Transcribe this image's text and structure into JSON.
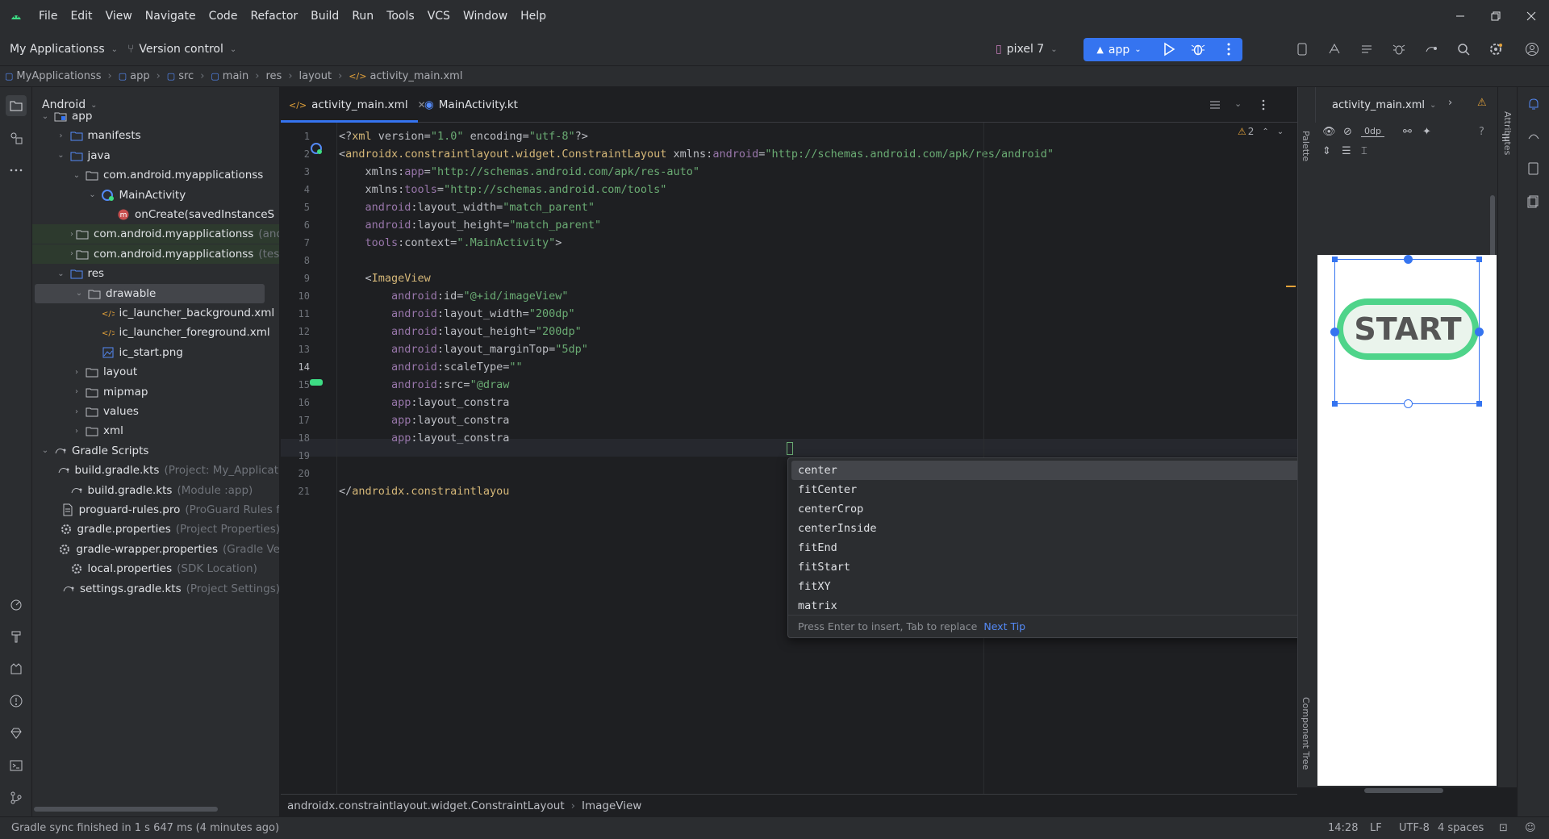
{
  "menu": [
    "File",
    "Edit",
    "View",
    "Navigate",
    "Code",
    "Refactor",
    "Build",
    "Run",
    "Tools",
    "VCS",
    "Window",
    "Help"
  ],
  "toolbar": {
    "project_name": "My Applicationss",
    "vcs_label": "Version control",
    "device": "pixel 7",
    "run_config": "app"
  },
  "breadcrumb": [
    "MyApplicationss",
    "app",
    "src",
    "main",
    "res",
    "layout",
    "activity_main.xml"
  ],
  "project_panel": {
    "view_mode": "Android",
    "tree": [
      {
        "label": "app",
        "dim": ""
      },
      {
        "label": "manifests",
        "dim": ""
      },
      {
        "label": "java",
        "dim": ""
      },
      {
        "label": "com.android.myapplicationss",
        "dim": ""
      },
      {
        "label": "MainActivity",
        "dim": ""
      },
      {
        "label": "onCreate(savedInstanceS",
        "dim": ""
      },
      {
        "label": "com.android.myapplicationss",
        "dim": "(andr"
      },
      {
        "label": "com.android.myapplicationss",
        "dim": "(test"
      },
      {
        "label": "res",
        "dim": ""
      },
      {
        "label": "drawable",
        "dim": ""
      },
      {
        "label": "ic_launcher_background.xml",
        "dim": ""
      },
      {
        "label": "ic_launcher_foreground.xml",
        "dim": ""
      },
      {
        "label": "ic_start.png",
        "dim": ""
      },
      {
        "label": "layout",
        "dim": ""
      },
      {
        "label": "mipmap",
        "dim": ""
      },
      {
        "label": "values",
        "dim": ""
      },
      {
        "label": "xml",
        "dim": ""
      },
      {
        "label": "Gradle Scripts",
        "dim": ""
      },
      {
        "label": "build.gradle.kts",
        "dim": "(Project: My_Applicati"
      },
      {
        "label": "build.gradle.kts",
        "dim": "(Module :app)"
      },
      {
        "label": "proguard-rules.pro",
        "dim": "(ProGuard Rules f"
      },
      {
        "label": "gradle.properties",
        "dim": "(Project Properties)"
      },
      {
        "label": "gradle-wrapper.properties",
        "dim": "(Gradle Ve"
      },
      {
        "label": "local.properties",
        "dim": "(SDK Location)"
      },
      {
        "label": "settings.gradle.kts",
        "dim": "(Project Settings)"
      }
    ]
  },
  "editor": {
    "tabs": [
      "activity_main.xml",
      "MainActivity.kt"
    ],
    "warning_count": "2",
    "lines": [
      [
        {
          "c": "ps",
          "t": "<?"
        },
        {
          "c": "tg",
          "t": "xml "
        },
        {
          "c": "at",
          "t": "version="
        },
        {
          "c": "sv",
          "t": "\"1.0\""
        },
        {
          "c": "at",
          "t": " encoding="
        },
        {
          "c": "sv",
          "t": "\"utf-8\""
        },
        {
          "c": "ps",
          "t": "?>"
        }
      ],
      [
        {
          "c": "ps",
          "t": "<"
        },
        {
          "c": "tg",
          "t": "androidx.constraintlayout.widget.ConstraintLayout "
        },
        {
          "c": "at",
          "t": "xmlns:"
        },
        {
          "c": "ns",
          "t": "android"
        },
        {
          "c": "at",
          "t": "="
        },
        {
          "c": "sv",
          "t": "\"http://schemas.android.com/apk/res/android\""
        }
      ],
      [
        {
          "c": "at",
          "t": "    xmlns:"
        },
        {
          "c": "ns",
          "t": "app"
        },
        {
          "c": "at",
          "t": "="
        },
        {
          "c": "sv",
          "t": "\"http://schemas.android.com/apk/res-auto\""
        }
      ],
      [
        {
          "c": "at",
          "t": "    xmlns:"
        },
        {
          "c": "ns",
          "t": "tools"
        },
        {
          "c": "at",
          "t": "="
        },
        {
          "c": "sv",
          "t": "\"http://schemas.android.com/tools\""
        }
      ],
      [
        {
          "c": "ns",
          "t": "    android"
        },
        {
          "c": "at",
          "t": ":layout_width="
        },
        {
          "c": "sv",
          "t": "\"match_parent\""
        }
      ],
      [
        {
          "c": "ns",
          "t": "    android"
        },
        {
          "c": "at",
          "t": ":layout_height="
        },
        {
          "c": "sv",
          "t": "\"match_parent\""
        }
      ],
      [
        {
          "c": "ns",
          "t": "    tools"
        },
        {
          "c": "at",
          "t": ":context="
        },
        {
          "c": "sv",
          "t": "\".MainActivity\""
        },
        {
          "c": "ps",
          "t": ">"
        }
      ],
      [],
      [
        {
          "c": "ps",
          "t": "    <"
        },
        {
          "c": "tg",
          "t": "ImageView"
        }
      ],
      [
        {
          "c": "ns",
          "t": "        android"
        },
        {
          "c": "at",
          "t": ":id="
        },
        {
          "c": "sv",
          "t": "\"@+id/imageView\""
        }
      ],
      [
        {
          "c": "ns",
          "t": "        android"
        },
        {
          "c": "at",
          "t": ":layout_width="
        },
        {
          "c": "sv",
          "t": "\"200dp\""
        }
      ],
      [
        {
          "c": "ns",
          "t": "        android"
        },
        {
          "c": "at",
          "t": ":layout_height="
        },
        {
          "c": "sv",
          "t": "\"200dp\""
        }
      ],
      [
        {
          "c": "ns",
          "t": "        android"
        },
        {
          "c": "at",
          "t": ":layout_marginTop="
        },
        {
          "c": "sv",
          "t": "\"5dp\""
        }
      ],
      [
        {
          "c": "ns",
          "t": "        android"
        },
        {
          "c": "at",
          "t": ":scaleType="
        },
        {
          "c": "sv",
          "t": "\"\""
        }
      ],
      [
        {
          "c": "ns",
          "t": "        android"
        },
        {
          "c": "at",
          "t": ":src="
        },
        {
          "c": "sv",
          "t": "\"@draw"
        }
      ],
      [
        {
          "c": "ns",
          "t": "        app"
        },
        {
          "c": "at",
          "t": ":layout_constra"
        }
      ],
      [
        {
          "c": "ns",
          "t": "        app"
        },
        {
          "c": "at",
          "t": ":layout_constra"
        }
      ],
      [
        {
          "c": "ns",
          "t": "        app"
        },
        {
          "c": "at",
          "t": ":layout_constra"
        }
      ],
      [],
      [],
      [
        {
          "c": "ps",
          "t": "</"
        },
        {
          "c": "tg",
          "t": "androidx.constraintlayou"
        }
      ]
    ],
    "completion": {
      "items": [
        "center",
        "fitCenter",
        "centerCrop",
        "centerInside",
        "fitEnd",
        "fitStart",
        "fitXY",
        "matrix"
      ],
      "hint": "Press Enter to insert, Tab to replace",
      "tip_link": "Next Tip"
    },
    "bottom_breadcrumb": [
      "androidx.constraintlayout.widget.ConstraintLayout",
      "ImageView"
    ]
  },
  "design": {
    "file": "activity_main.xml",
    "margin_value": "0dp",
    "preview_text": "START",
    "palette_label": "Palette",
    "component_tree_label": "Component Tree",
    "attributes_label": "Attributes"
  },
  "status": {
    "message": "Gradle sync finished in 1 s 647 ms (4 minutes ago)",
    "position": "14:28",
    "line_sep": "LF",
    "encoding": "UTF-8",
    "indent": "4 spaces"
  },
  "colors": {
    "accent": "#3574f0",
    "bg": "#1e1f22",
    "panel": "#2b2d30",
    "string": "#6aab73",
    "tag": "#d5b778",
    "namespace": "#9876aa"
  }
}
